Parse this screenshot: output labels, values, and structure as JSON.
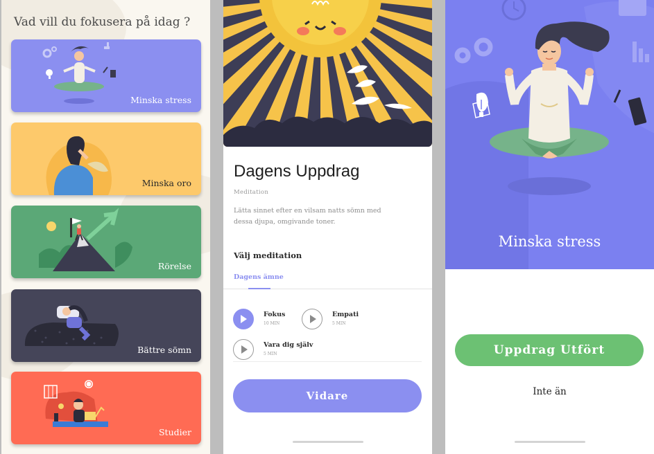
{
  "focus_screen": {
    "title": "Vad vill du fokusera på idag ?",
    "cards": [
      {
        "label": "Minska stress",
        "color": "#8b8ff0",
        "label_color": "#ffffff",
        "icon": "meditation-illustration"
      },
      {
        "label": "Minska oro",
        "color": "#fdc96b",
        "label_color": "#2b2b2b",
        "icon": "worried-woman-illustration"
      },
      {
        "label": "Rörelse",
        "color": "#5ba877",
        "label_color": "#ffffff",
        "icon": "mountain-climber-illustration"
      },
      {
        "label": "Bättre sömn",
        "color": "#454559",
        "label_color": "#ffffff",
        "icon": "sleeping-person-illustration"
      },
      {
        "label": "Studier",
        "color": "#ff6b54",
        "label_color": "#ffffff",
        "icon": "studying-person-illustration"
      }
    ]
  },
  "mission_screen": {
    "heading": "Dagens Uppdrag",
    "category": "Meditation",
    "description": "Lätta sinnet efter en vilsam natts sömn med dessa djupa, omgivande toner.",
    "select_label": "Välj meditation",
    "tab_label": "Dagens ämne",
    "meditations": [
      {
        "title": "Fokus",
        "duration": "10 MIN",
        "active": true
      },
      {
        "title": "Empati",
        "duration": "5 MIN",
        "active": false
      },
      {
        "title": "Vara dig själv",
        "duration": "5 MIN",
        "active": false
      }
    ],
    "continue_label": "Vidare",
    "accent_color": "#8b8ff0"
  },
  "detail_screen": {
    "title": "Minska stress",
    "done_label": "Uppdrag Utfört",
    "not_yet_label": "Inte än",
    "hero_color": "#7b80f0",
    "done_color": "#6cc173"
  }
}
